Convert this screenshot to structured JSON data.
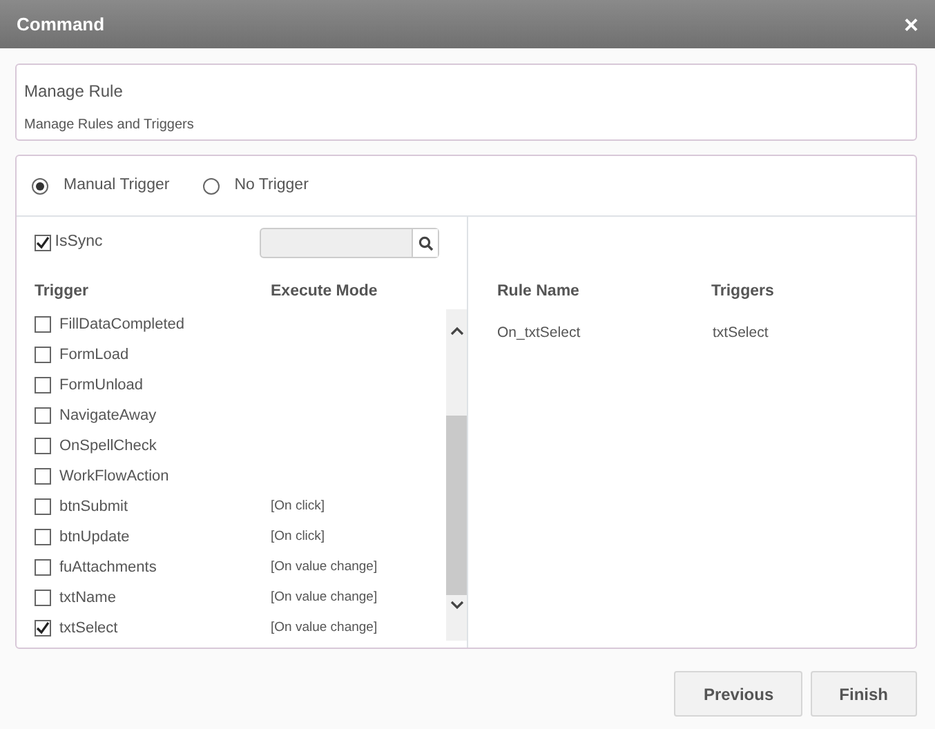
{
  "window": {
    "title": "Command",
    "close": "×"
  },
  "header": {
    "title": "Manage Rule",
    "subtitle": "Manage Rules and Triggers"
  },
  "trigger_options": [
    {
      "label": "Manual Trigger",
      "selected": true
    },
    {
      "label": "No Trigger",
      "selected": false
    }
  ],
  "is_sync": {
    "label": "IsSync",
    "checked": true
  },
  "trigger_table": {
    "columns": [
      "Trigger",
      "Execute Mode"
    ],
    "rows": [
      {
        "name": "FillDataCompleted",
        "mode": "",
        "checked": false
      },
      {
        "name": "FormLoad",
        "mode": "",
        "checked": false
      },
      {
        "name": "FormUnload",
        "mode": "",
        "checked": false
      },
      {
        "name": "NavigateAway",
        "mode": "",
        "checked": false
      },
      {
        "name": "OnSpellCheck",
        "mode": "",
        "checked": false
      },
      {
        "name": "WorkFlowAction",
        "mode": "",
        "checked": false
      },
      {
        "name": "btnSubmit",
        "mode": "[On click]",
        "checked": false
      },
      {
        "name": "btnUpdate",
        "mode": "[On click]",
        "checked": false
      },
      {
        "name": "fuAttachments",
        "mode": "[On value change]",
        "checked": false
      },
      {
        "name": "txtName",
        "mode": "[On value change]",
        "checked": false
      },
      {
        "name": "txtSelect",
        "mode": "[On value change]",
        "checked": true
      }
    ]
  },
  "rule_table": {
    "columns": [
      "Rule Name",
      "Triggers"
    ],
    "rows": [
      {
        "rule_name": "On_txtSelect",
        "triggers": "txtSelect"
      }
    ]
  },
  "buttons": [
    "Previous",
    "Finish"
  ]
}
